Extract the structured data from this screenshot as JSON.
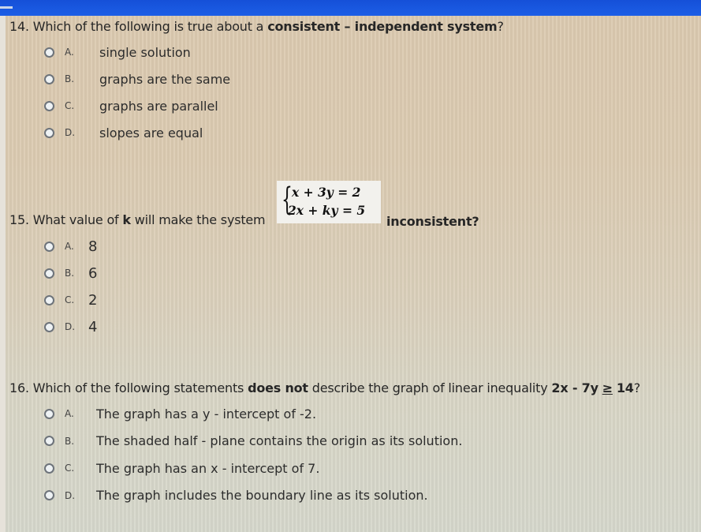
{
  "colors": {
    "top_bar": "#1c5ee6",
    "background": "#dccab0",
    "equation_box": "#f2f1ed",
    "radio_border": "#6d737a"
  },
  "questions": [
    {
      "number": "14.",
      "text_before": "Which of the following is true about a",
      "bold_text": "consistent – independent system",
      "text_after": "?",
      "options": [
        {
          "letter": "A.",
          "text": "single solution"
        },
        {
          "letter": "B.",
          "text": "graphs are the same"
        },
        {
          "letter": "C.",
          "text": "graphs are parallel"
        },
        {
          "letter": "D.",
          "text": "slopes are equal"
        }
      ]
    },
    {
      "number": "15.",
      "text_before": "What value of",
      "bold_var": "k",
      "text_middle": "will make the system",
      "system": {
        "brace": "{",
        "eq1": "x + 3y = 2",
        "eq2": "2x + ky = 5"
      },
      "text_after": "inconsistent?",
      "options": [
        {
          "letter": "A.",
          "text": "8"
        },
        {
          "letter": "B.",
          "text": "6"
        },
        {
          "letter": "C.",
          "text": "2"
        },
        {
          "letter": "D.",
          "text": "4"
        }
      ]
    },
    {
      "number": "16.",
      "text_before": "Which of the following statements",
      "bold_text": "does not",
      "text_middle": "describe the graph of linear inequality",
      "inequality_lhs": "2x - 7y",
      "inequality_op": "≥",
      "inequality_rhs": "14",
      "text_after": "?",
      "options": [
        {
          "letter": "A.",
          "text": "The graph has a y - intercept of -2."
        },
        {
          "letter": "B.",
          "text": "The shaded half - plane contains the origin as its solution."
        },
        {
          "letter": "C.",
          "text": "The graph has an x - intercept of 7."
        },
        {
          "letter": "D.",
          "text": "The graph includes the boundary line as its solution."
        }
      ]
    }
  ]
}
